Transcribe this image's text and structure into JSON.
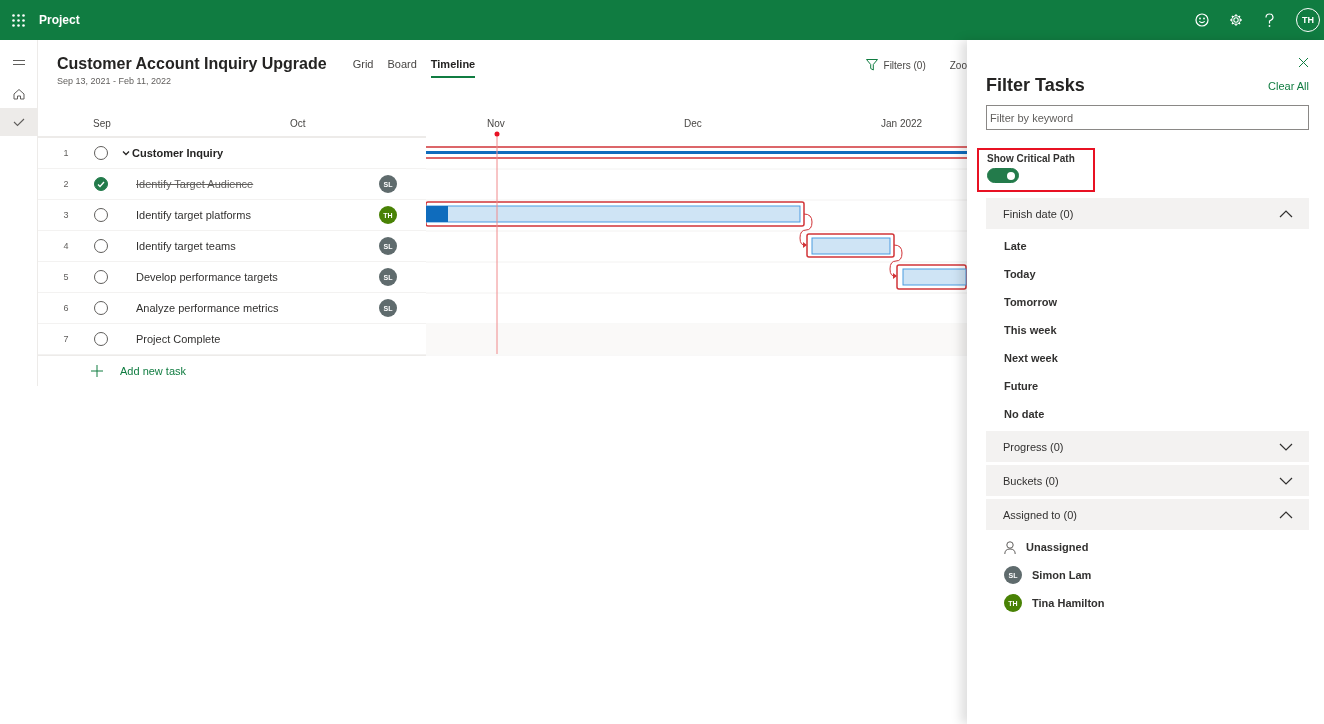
{
  "app": {
    "title": "Project",
    "user_initials": "TH"
  },
  "rail": [
    {
      "kind": "home",
      "selected": false
    },
    {
      "kind": "tasks",
      "selected": true
    }
  ],
  "project": {
    "title": "Customer Account Inquiry Upgrade",
    "dates": "Sep 13, 2021 - Feb 11, 2022"
  },
  "views": [
    {
      "label": "Grid",
      "selected": false
    },
    {
      "label": "Board",
      "selected": false
    },
    {
      "label": "Timeline",
      "selected": true
    }
  ],
  "toolbar": {
    "filters": "Filters (0)",
    "zoom": "Zoo"
  },
  "months": [
    "Sep",
    "Oct",
    "Nov",
    "Dec",
    "Jan 2022"
  ],
  "tasks": [
    {
      "number": "1",
      "name": "Customer Inquiry",
      "kind": "group",
      "expanded": true,
      "completed": false
    },
    {
      "number": "2",
      "name": "Identify Target Audience",
      "kind": "task",
      "completed": true,
      "assignee": {
        "initials": "SL",
        "color": "#5f6b6d"
      }
    },
    {
      "number": "3",
      "name": "Identify target platforms",
      "kind": "task",
      "completed": false,
      "assignee": {
        "initials": "TH",
        "color": "#498205"
      }
    },
    {
      "number": "4",
      "name": "Identify target teams",
      "kind": "task",
      "completed": false,
      "assignee": {
        "initials": "SL",
        "color": "#5f6b6d"
      }
    },
    {
      "number": "5",
      "name": "Develop performance targets",
      "kind": "task",
      "completed": false,
      "assignee": {
        "initials": "SL",
        "color": "#5f6b6d"
      }
    },
    {
      "number": "6",
      "name": "Analyze performance metrics",
      "kind": "task",
      "completed": false,
      "assignee": {
        "initials": "SL",
        "color": "#5f6b6d"
      }
    },
    {
      "number": "7",
      "name": "Project Complete",
      "kind": "task",
      "completed": false
    }
  ],
  "add_task": "Add new task",
  "panel": {
    "title": "Filter Tasks",
    "clear_all": "Clear All",
    "search": {
      "placeholder": "Filter by keyword"
    },
    "critical_path": {
      "label": "Show Critical Path",
      "on": true
    },
    "sections": [
      {
        "label": "Finish date (0)",
        "expanded": true,
        "items": [
          {
            "kind": "option",
            "name": "Late"
          },
          {
            "kind": "option",
            "name": "Today"
          },
          {
            "kind": "option",
            "name": "Tomorrow"
          },
          {
            "kind": "option",
            "name": "This week"
          },
          {
            "kind": "option",
            "name": "Next week"
          },
          {
            "kind": "option",
            "name": "Future"
          },
          {
            "kind": "option",
            "name": "No date"
          }
        ]
      },
      {
        "label": "Progress (0)",
        "expanded": false
      },
      {
        "label": "Buckets (0)",
        "expanded": false
      },
      {
        "label": "Assigned to (0)",
        "expanded": true,
        "items": [
          {
            "kind": "unassigned",
            "name": "Unassigned"
          },
          {
            "kind": "person",
            "name": "Simon Lam",
            "initials": "SL",
            "color": "#5f6b6d"
          },
          {
            "kind": "person",
            "name": "Tina Hamilton",
            "initials": "TH",
            "color": "#498205"
          }
        ]
      }
    ]
  }
}
